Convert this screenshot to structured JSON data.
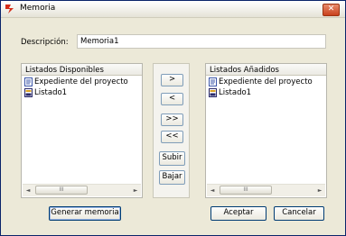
{
  "window": {
    "title": "Memoria",
    "close_glyph": "✕"
  },
  "description": {
    "label": "Descripción:",
    "value": "Memoria1"
  },
  "available_list": {
    "header": "Listados Disponibles",
    "items": [
      {
        "label": "Expediente del proyecto",
        "icon": "document-icon"
      },
      {
        "label": "Listado1",
        "icon": "report-icon"
      }
    ]
  },
  "added_list": {
    "header": "Listados Añadidos",
    "items": [
      {
        "label": "Expediente del proyecto",
        "icon": "document-icon"
      },
      {
        "label": "Listado1",
        "icon": "report-icon"
      }
    ]
  },
  "transfer_buttons": {
    "add": ">",
    "remove": "<",
    "add_all": ">>",
    "remove_all": "<<",
    "move_up": "Subir",
    "move_down": "Bajar"
  },
  "scroll": {
    "left": "◄",
    "right": "►",
    "thumb": "III"
  },
  "footer": {
    "generate": "Generar memoria",
    "accept": "Aceptar",
    "cancel": "Cancelar"
  },
  "colors": {
    "title_border": "#0a246a",
    "dialog_bg": "#ece9d8",
    "button_border": "#003c74",
    "close_red": "#c8401c"
  }
}
